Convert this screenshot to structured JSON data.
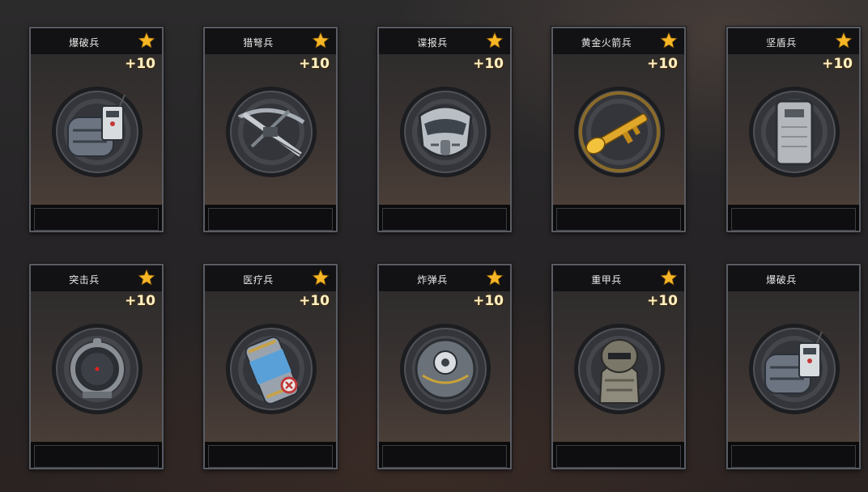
{
  "cards": [
    {
      "title": "爆破兵",
      "level": "+10",
      "starred": true,
      "item": "c4-bomb-icon",
      "gems_lit": true
    },
    {
      "title": "猎弩兵",
      "level": "+10",
      "starred": true,
      "item": "crossbow-icon",
      "gems_lit": true
    },
    {
      "title": "谍报兵",
      "level": "+10",
      "starred": true,
      "item": "mask-icon",
      "gems_lit": true
    },
    {
      "title": "黄金火箭兵",
      "level": "+10",
      "starred": true,
      "item": "rpg-launcher-icon",
      "gems_lit": true
    },
    {
      "title": "坚盾兵",
      "level": "+10",
      "starred": true,
      "item": "shield-icon",
      "gems_lit": true
    },
    {
      "title": "突击兵",
      "level": "+10",
      "starred": true,
      "item": "scope-icon",
      "gems_lit": true
    },
    {
      "title": "医疗兵",
      "level": "+10",
      "starred": true,
      "item": "medkit-canister-icon",
      "gems_lit": true
    },
    {
      "title": "炸弹兵",
      "level": "+10",
      "starred": true,
      "item": "sphere-bomb-icon",
      "gems_lit": true
    },
    {
      "title": "重甲兵",
      "level": "+10",
      "starred": true,
      "item": "heavy-armor-icon",
      "gems_lit": true
    },
    {
      "title": "爆破兵",
      "level": "",
      "starred": false,
      "item": "c4-bomb-icon",
      "gems_lit": false
    }
  ],
  "gem_colors": [
    "#e23b4a",
    "#e23b4a",
    "#e23b4a",
    "#39a0e6",
    "#39a0e6",
    "#39a0e6",
    "#e3b52a",
    "#e3b52a",
    "#e3b52a",
    "#8f5ce0"
  ],
  "gem_unlit_color": "#2a2d33",
  "accent_gold": "#f6b625"
}
